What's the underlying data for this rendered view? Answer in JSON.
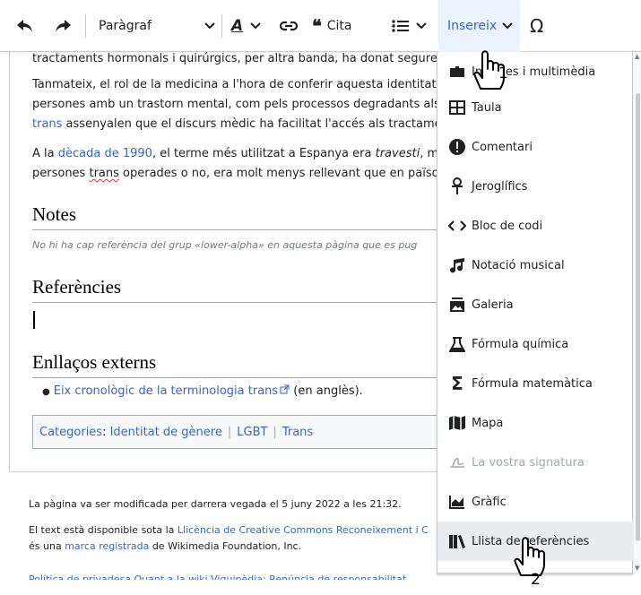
{
  "toolbar": {
    "format_select": "Paràgraf",
    "cite_label": "Cita",
    "insert_label": "Insereix",
    "special_char": "Ω"
  },
  "article": {
    "line1": "tractaments hormonals i quirúrgics, per altra banda, ha donat segureta",
    "line2": "Tanmateix, el rol de la medicina a l'hora de conferir aquesta identitat h",
    "line3": "persones amb un trastorn mental, com pels processos degradants als",
    "line4_link": "trans",
    "line4_rest": " assenyalen que el discurs mèdic ha facilitat l'accés als tractame",
    "line5_pre": "A la ",
    "line5_link": "dècada de 1990",
    "line5_mid": ", el terme més utilitzat a Espanya era ",
    "line5_em": "travesti",
    "line5_post": ", me",
    "line6_pre": "persones ",
    "line6_link": "trans",
    "line6_post": " operades o no, era molt menys rellevant que en païso",
    "notes_heading": "Notes",
    "notes_text": "No hi ha cap referència del grup «lower-alpha» en aquesta pàgina que es pug",
    "refs_heading": "Referències",
    "links_heading": "Enllaços externs",
    "ext_link": "Eix cronològic de la terminologia ",
    "ext_link_word": "trans",
    "ext_suffix": " (en anglès).",
    "categories_label": "Categories",
    "categories": [
      "Identitat de gènere",
      "LGBT",
      "Trans"
    ]
  },
  "footer": {
    "modified": "La pàgina va ser modificada per darrera vegada el 5 juny 2022 a les 21:32.",
    "license_pre": "El text està disponible sota la ",
    "license_link": "Llicència de Creative Commons Reconeixement i Co",
    "trademark_pre": "és una ",
    "trademark_link": "marca registrada",
    "trademark_post": " de Wikimedia Foundation, Inc.",
    "bottom_links": "Política de privadesa  Quant a la wiki  Viquipèdia: Renúncia de responsabilitat"
  },
  "insert_menu": {
    "items": [
      {
        "label": "Imatges i multimèdia",
        "icon": "image-icon"
      },
      {
        "label": "Taula",
        "icon": "table-icon"
      },
      {
        "label": "Comentari",
        "icon": "comment-icon"
      },
      {
        "label": "Jeroglífics",
        "icon": "ankh-icon"
      },
      {
        "label": "Bloc de codi",
        "icon": "code-icon"
      },
      {
        "label": "Notació musical",
        "icon": "music-icon"
      },
      {
        "label": "Galeria",
        "icon": "gallery-icon"
      },
      {
        "label": "Fórmula química",
        "icon": "flask-icon"
      },
      {
        "label": "Fórmula matemàtica",
        "icon": "sigma-icon"
      },
      {
        "label": "Mapa",
        "icon": "map-icon"
      },
      {
        "label": "La vostra signatura",
        "icon": "signature-icon",
        "disabled": true
      },
      {
        "label": "Gràfic",
        "icon": "chart-icon"
      },
      {
        "label": "Llista de referències",
        "icon": "references-icon",
        "highlighted": true
      }
    ]
  },
  "annotations": {
    "step1": "1",
    "step2": "2"
  },
  "colors": {
    "link": "#3366cc",
    "insert_bg": "#eaf3ff",
    "hover_bg": "#eaecf0",
    "border": "#c8ccd1"
  }
}
